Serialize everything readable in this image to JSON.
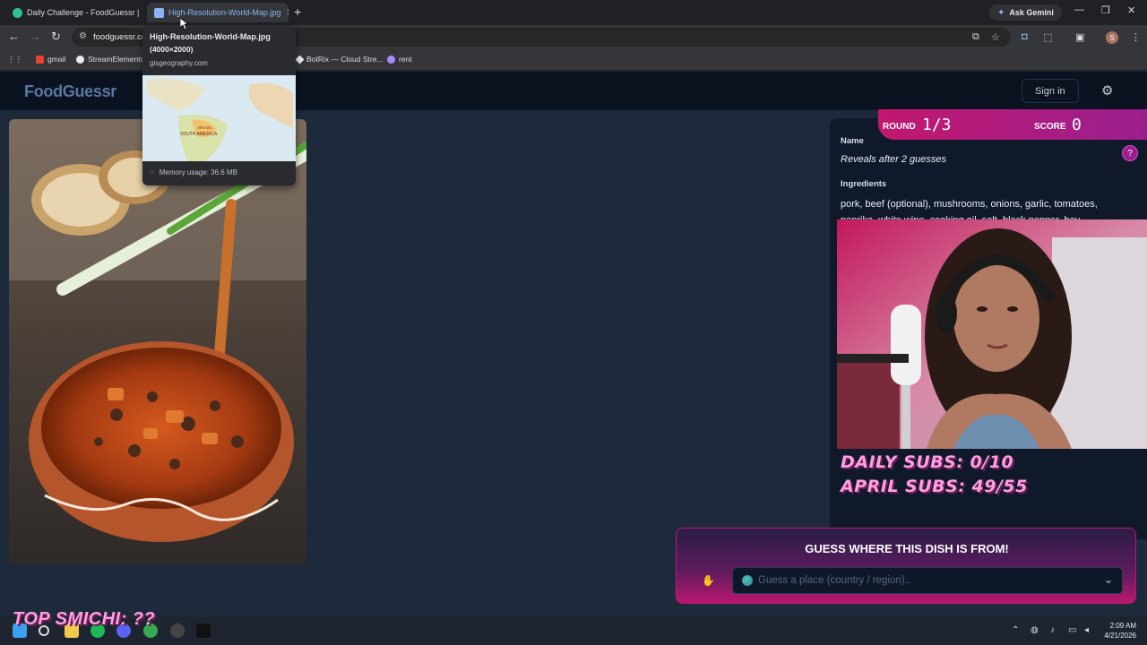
{
  "browser": {
    "tabs": [
      {
        "title": "Daily Challenge - FoodGuessr |",
        "active": false
      },
      {
        "title": "High-Resolution-World-Map.jpg",
        "active": true
      }
    ],
    "gemini_label": "Ask Gemini",
    "url": "foodguessr.co",
    "bookmarks": [
      "gmail",
      "StreamElements",
      "BotRix — Cloud Stre...",
      "rent"
    ],
    "profile_initial": "S"
  },
  "tooltip": {
    "title": "High-Resolution-World-Map.jpg",
    "dimensions": "(4000×2000)",
    "host": "gisgeography.com",
    "map_labels": [
      "SOUTH AMERICA",
      "BRAZIL"
    ],
    "memory": "Memory usage: 36.6 MB"
  },
  "site": {
    "logo": "FoodGuessr",
    "signin_label": "Sign in"
  },
  "game": {
    "round_label": "ROUND",
    "round_value": "1/3",
    "score_label": "SCORE",
    "score_value": "0",
    "name_label": "Name",
    "name_value": "Reveals after 2 guesses",
    "ingredients_label": "Ingredients",
    "ingredients_line1": "pork, beef (optional), mushrooms, onions, garlic, tomatoes,",
    "ingredients_line2": "paprika, white wine, cooking oil, salt, black pepper, bay",
    "guess_title": "GUESS WHERE THIS DISH IS FROM!",
    "guess_placeholder": "Guess a place (country / region).."
  },
  "overlay": {
    "daily_subs": "DAILY SUBS: 0/10",
    "april_subs": "APRIL SUBS: 49/55",
    "top_text": "TOP SMICHI: ??"
  },
  "taskbar": {
    "time": "2:09 AM",
    "date": "4/21/2026"
  },
  "colors": {
    "accent_pink": "#c2186f",
    "page_bg": "#1d2a3b",
    "header_bg": "#0b1321"
  }
}
